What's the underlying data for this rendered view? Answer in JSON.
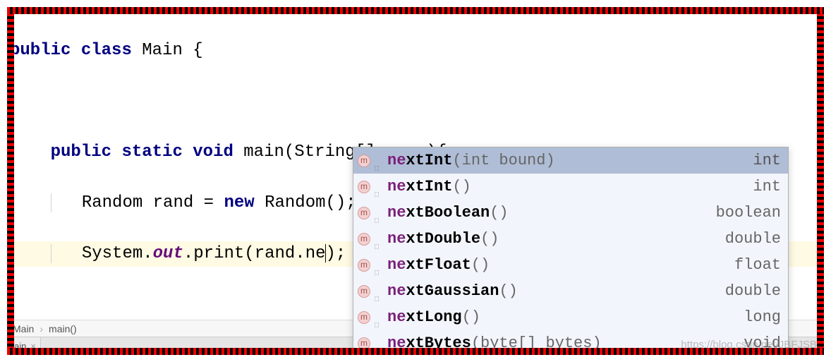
{
  "code": {
    "line1": {
      "kw1": "public",
      "kw2": "class",
      "name": "Main",
      "brace": " {"
    },
    "line3": {
      "kw1": "public",
      "kw2": "static",
      "kw3": "void",
      "name": "main",
      "params": "(String[] name){"
    },
    "line4": {
      "p1": "Random rand = ",
      "kw": "new",
      "p2": " Random();"
    },
    "line5": {
      "p1": "System.",
      "field": "out",
      "p2": ".print(rand.ne",
      "p3": ");"
    }
  },
  "suggestions": [
    {
      "match": "ne",
      "rest": "xtInt",
      "params": "(int bound)",
      "ret": "int",
      "selected": true
    },
    {
      "match": "ne",
      "rest": "xtInt",
      "params": "()",
      "ret": "int",
      "selected": false
    },
    {
      "match": "ne",
      "rest": "xtBoolean",
      "params": "()",
      "ret": "boolean",
      "selected": false
    },
    {
      "match": "ne",
      "rest": "xtDouble",
      "params": "()",
      "ret": "double",
      "selected": false
    },
    {
      "match": "ne",
      "rest": "xtFloat",
      "params": "()",
      "ret": "float",
      "selected": false
    },
    {
      "match": "ne",
      "rest": "xtGaussian",
      "params": "()",
      "ret": "double",
      "selected": false
    },
    {
      "match": "ne",
      "rest": "xtLong",
      "params": "()",
      "ret": "long",
      "selected": false
    },
    {
      "match": "ne",
      "rest": "xtBytes",
      "params": "(byte[] bytes)",
      "ret": "void",
      "selected": false
    }
  ],
  "icon_letter": "m",
  "breadcrumb": {
    "c1": "Main",
    "c2": "main()"
  },
  "tab": {
    "label": "ain",
    "close": "×"
  },
  "watermark": "https://blog.csdn.net/JBFJSB"
}
